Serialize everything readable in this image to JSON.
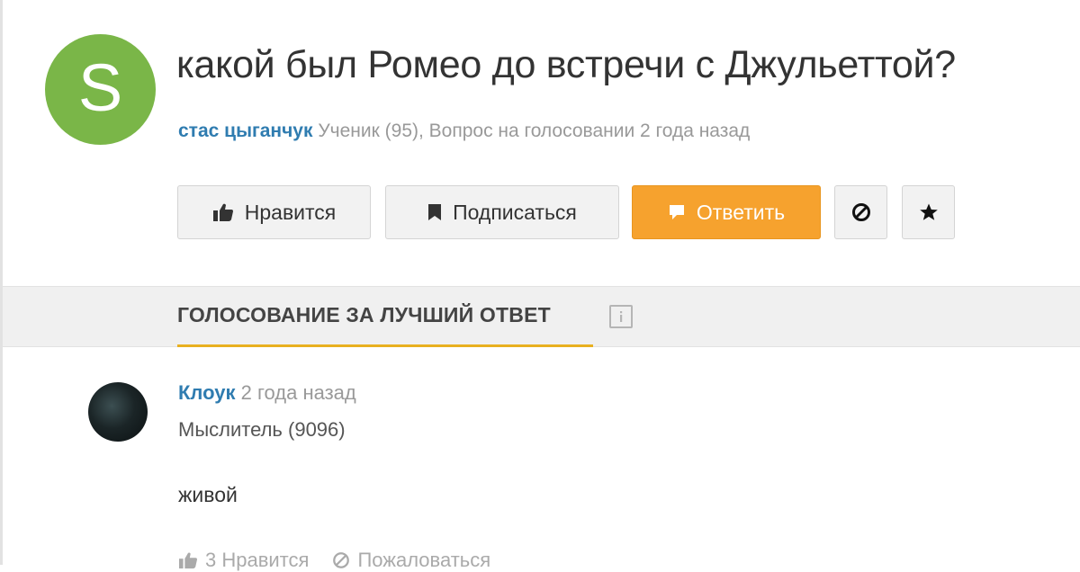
{
  "question": {
    "avatar_letter": "S",
    "avatar_color": "#7ab648",
    "title": "какой был Ромео до встречи с Джульеттой?",
    "author": "стас цыганчук",
    "meta": " Ученик (95), Вопрос на голосовании 2 года назад"
  },
  "buttons": {
    "like": "Нравится",
    "subscribe": "Подписаться",
    "answer": "Ответить",
    "block_icon": "block-icon",
    "star_icon": "star-icon"
  },
  "vote": {
    "tab_label": "ГОЛОСОВАНИЕ ЗА ЛУЧШИЙ ОТВЕТ",
    "accent": "#e8b020"
  },
  "answer": {
    "author": "Клоук",
    "time": " 2 года назад",
    "rank": "Мыслитель (9096)",
    "text": "живой",
    "likes": "3 Нравится",
    "report": "Пожаловаться"
  },
  "colors": {
    "answer_button": "#f6a22e",
    "link": "#2f7cb0"
  }
}
